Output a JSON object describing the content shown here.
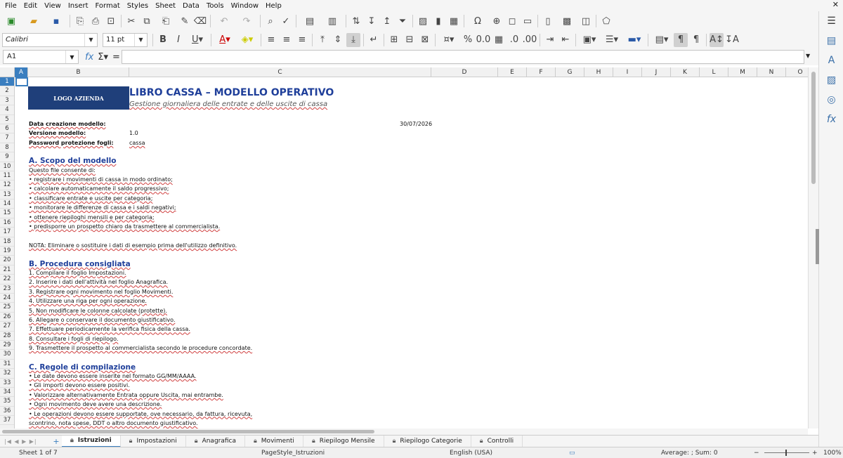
{
  "menu": [
    "File",
    "Edit",
    "View",
    "Insert",
    "Format",
    "Styles",
    "Sheet",
    "Data",
    "Tools",
    "Window",
    "Help"
  ],
  "font": {
    "name": "Calibri",
    "size": "11 pt"
  },
  "namebox": "A1",
  "columns": [
    {
      "label": "A",
      "w": 19
    },
    {
      "label": "B",
      "w": 144
    },
    {
      "label": "C",
      "w": 430
    },
    {
      "label": "D",
      "w": 95
    },
    {
      "label": "E",
      "w": 41
    },
    {
      "label": "F",
      "w": 41
    },
    {
      "label": "G",
      "w": 41
    },
    {
      "label": "H",
      "w": 41
    },
    {
      "label": "I",
      "w": 41
    },
    {
      "label": "J",
      "w": 41
    },
    {
      "label": "K",
      "w": 41
    },
    {
      "label": "L",
      "w": 41
    },
    {
      "label": "M",
      "w": 41
    },
    {
      "label": "N",
      "w": 41
    },
    {
      "label": "O",
      "w": 41
    }
  ],
  "rows": [
    "1",
    "2",
    "3",
    "4",
    "5",
    "6",
    "7",
    "8",
    "9",
    "10",
    "11",
    "12",
    "13",
    "14",
    "15",
    "16",
    "17",
    "18",
    "19",
    "20",
    "21",
    "22",
    "23",
    "24",
    "25",
    "26",
    "27",
    "28",
    "29",
    "30",
    "31",
    "32",
    "33",
    "34",
    "35",
    "36",
    "37"
  ],
  "sheet": {
    "logo": "LOGO AZIENDA",
    "title": "LIBRO CASSA – MODELLO OPERATIVO",
    "subtitle": "Gestione giornaliera delle entrate e delle uscite di cassa",
    "info": [
      {
        "label": "Data creazione modello:",
        "value": "",
        "extra": "30/07/2026"
      },
      {
        "label": "Versione modello:",
        "value": "1.0",
        "extra": ""
      },
      {
        "label": "Password protezione fogli:",
        "value": "cassa",
        "extra": ""
      }
    ],
    "sectionA": {
      "heading": "A. Scopo del modello",
      "intro": "Questo file consente di:",
      "items": [
        "• registrare i movimenti di cassa in modo ordinato;",
        "• calcolare automaticamente il saldo progressivo;",
        "• classificare entrate e uscite per categoria;",
        "• monitorare le differenze di cassa e i saldi negativi;",
        "• ottenere riepiloghi mensili e per categoria;",
        "• predisporre un prospetto chiaro da trasmettere al commercialista."
      ],
      "note": "NOTA: Eliminare o sostituire i dati di esempio prima dell'utilizzo definitivo."
    },
    "sectionB": {
      "heading": "B. Procedura consigliata",
      "items": [
        "1. Compilare il foglio Impostazioni.",
        "2. Inserire i dati dell'attività nel foglio Anagrafica.",
        "3. Registrare ogni movimento nel foglio Movimenti.",
        "4. Utilizzare una riga per ogni operazione.",
        "5. Non modificare le colonne calcolate (protette).",
        "6. Allegare o conservare il documento giustificativo.",
        "7. Effettuare periodicamente la verifica fisica della cassa.",
        "8. Consultare i fogli di riepilogo.",
        "9. Trasmettere il prospetto al commercialista secondo le procedure concordate."
      ]
    },
    "sectionC": {
      "heading": "C. Regole di compilazione",
      "items": [
        "• Le date devono essere inserite nel formato GG/MM/AAAA.",
        "• Gli importi devono essere positivi.",
        "• Valorizzare alternativamente Entrata oppure Uscita, mai entrambe.",
        "• Ogni movimento deve avere una descrizione.",
        "• Le operazioni devono essere supportate, ove necessario, da fattura, ricevuta,",
        "  scontrino, nota spese, DDT o altro documento giustificativo."
      ]
    }
  },
  "tabs": [
    "Istruzioni",
    "Impostazioni",
    "Anagrafica",
    "Movimenti",
    "Riepilogo Mensile",
    "Riepilogo Categorie",
    "Controlli"
  ],
  "status": {
    "sheet": "Sheet 1 of 7",
    "pagestyle": "PageStyle_Istruzioni",
    "lang": "English (USA)",
    "sum": "Average: ; Sum: 0",
    "zoom": "100%"
  },
  "colors": {
    "accent": "#3a7ebf",
    "title": "#1f3f9a",
    "logo_bg": "#1f3f7a"
  }
}
